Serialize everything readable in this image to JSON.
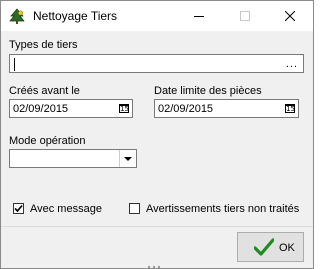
{
  "window": {
    "title": "Nettoyage Tiers",
    "app_icon": "pine-tree-icon",
    "controls": {
      "minimize": "—",
      "maximize": "☐",
      "close": "✕"
    }
  },
  "form": {
    "types_de_tiers": {
      "label": "Types de tiers",
      "value": "",
      "browse_button": "..."
    },
    "crees_avant_le": {
      "label": "Créés avant le",
      "value": "02/09/2015",
      "icon": "calendar-icon",
      "icon_text": "15"
    },
    "date_limite_pieces": {
      "label": "Date limite des pièces",
      "value": "02/09/2015",
      "icon": "calendar-icon",
      "icon_text": "15"
    },
    "mode_operation": {
      "label": "Mode opération",
      "value": ""
    },
    "avec_message": {
      "label": "Avec message",
      "checked": true
    },
    "avertissements": {
      "label": "Avertissements tiers non traités",
      "checked": false
    }
  },
  "buttons": {
    "ok": {
      "label": "OK",
      "icon": "checkmark-icon"
    }
  },
  "colors": {
    "window_bg": "#f0f0f0",
    "titlebar_bg": "#ffffff",
    "ok_check": "#1f8a1f"
  }
}
